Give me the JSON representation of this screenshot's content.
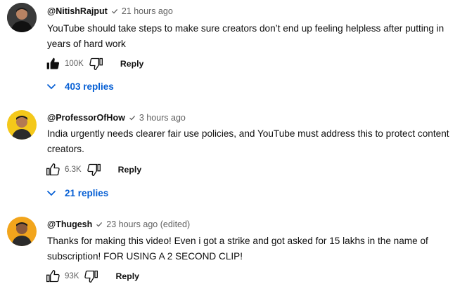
{
  "comments": [
    {
      "handle": "@NitishRajput",
      "time": "21 hours ago",
      "text": "YouTube should take steps to make sure creators don’t end up feeling helpless after putting in years of hard work",
      "likes": "100K",
      "reply_label": "Reply",
      "replies_label": "403 replies",
      "liked": true
    },
    {
      "handle": "@ProfessorOfHow",
      "time": "3 hours ago",
      "text": "India urgently needs clearer fair use policies, and YouTube must address this to protect content creators.",
      "likes": "6.3K",
      "reply_label": "Reply",
      "replies_label": "21 replies",
      "liked": false
    },
    {
      "handle": "@Thugesh",
      "time": "23 hours ago (edited)",
      "text": "Thanks for making this video! Even i got a strike and got asked for 15 lakhs in the name of subscription! FOR USING A 2 SECOND CLIP!",
      "likes": "93K",
      "reply_label": "Reply",
      "liked": false
    }
  ],
  "icons": [
    "verified-check-icon",
    "thumbs-up-icon",
    "thumbs-down-icon",
    "chevron-down-icon"
  ],
  "colors": {
    "link": "#065fd4",
    "meta": "#606060",
    "text": "#0f0f0f"
  }
}
